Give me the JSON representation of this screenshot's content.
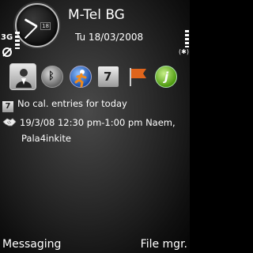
{
  "status": {
    "network_type": "3G",
    "operator": "M-Tel BG",
    "date": "Tu 18/03/2008",
    "clock_day": "18",
    "signal_level": 0.85,
    "battery_level": 1.0
  },
  "shortcuts": [
    {
      "name": "contacts",
      "icon": "contacts-icon",
      "selected": true
    },
    {
      "name": "bluetooth",
      "icon": "bluetooth-icon"
    },
    {
      "name": "sports tracker",
      "icon": "runner-icon"
    },
    {
      "name": "calendar",
      "icon": "calendar-icon",
      "label": "7"
    },
    {
      "name": "flag",
      "icon": "flag-icon"
    },
    {
      "name": "tips",
      "icon": "tips-icon",
      "label": "j"
    }
  ],
  "agenda": {
    "calendar_label": "7",
    "no_entries": "No cal. entries for today",
    "meeting_line1": "19/3/08 12:30 pm-1:00 pm Naem,",
    "meeting_line2": "Pala4inkite"
  },
  "softkeys": {
    "left": "Messaging",
    "right": "File mgr."
  },
  "colors": {
    "text": "#ffffff",
    "flag": "#e0651c",
    "tips": "#6fbf1d",
    "runner": "#2b66c8"
  }
}
